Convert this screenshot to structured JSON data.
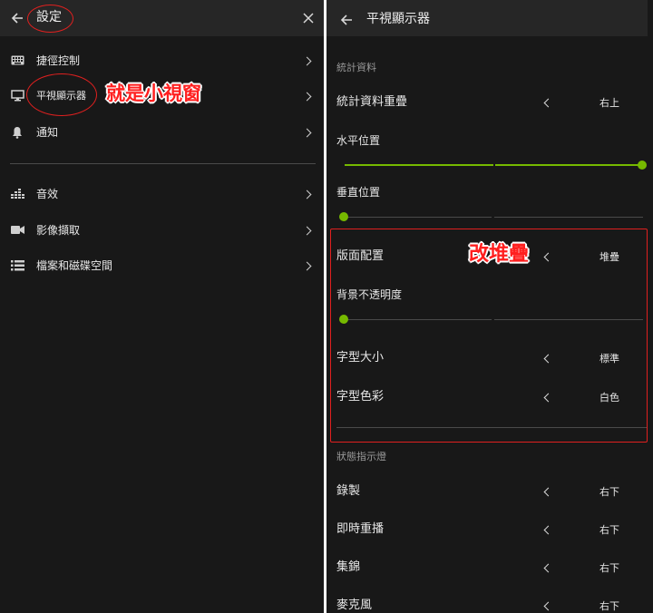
{
  "left": {
    "title": "設定",
    "menu": [
      {
        "label": "捷徑控制",
        "icon": "keyboard-icon"
      },
      {
        "label": "平視顯示器",
        "icon": "monitor-icon"
      },
      {
        "label": "通知",
        "icon": "bell-icon"
      },
      {
        "label": "音效",
        "icon": "equalizer-icon"
      },
      {
        "label": "影像擷取",
        "icon": "video-camera-icon"
      },
      {
        "label": "檔案和磁碟空間",
        "icon": "list-icon"
      }
    ],
    "annotation": "就是小視窗"
  },
  "right": {
    "title": "平視顯示器",
    "stats_section": "統計資料",
    "stats_overlay": {
      "label": "統計資料重疊",
      "value": "右上"
    },
    "horizontal": {
      "label": "水平位置",
      "value": 1.0
    },
    "vertical": {
      "label": "垂直位置",
      "value": 0.0
    },
    "layout": {
      "label": "版面配置",
      "value": "堆疊"
    },
    "opacity": {
      "label": "背景不透明度",
      "value": 0.0
    },
    "font_size": {
      "label": "字型大小",
      "value": "標準"
    },
    "font_color": {
      "label": "字型色彩",
      "value": "白色"
    },
    "status_section": "狀態指示燈",
    "indicators": [
      {
        "label": "錄製",
        "value": "右下"
      },
      {
        "label": "即時重播",
        "value": "右下"
      },
      {
        "label": "集錦",
        "value": "右下"
      },
      {
        "label": "麥克風",
        "value": "右下"
      }
    ],
    "annotation": "改堆疊"
  },
  "colors": {
    "accent": "#76b900",
    "annotation": "#e0201f",
    "panel": "#181818",
    "titlebar": "#262626"
  }
}
